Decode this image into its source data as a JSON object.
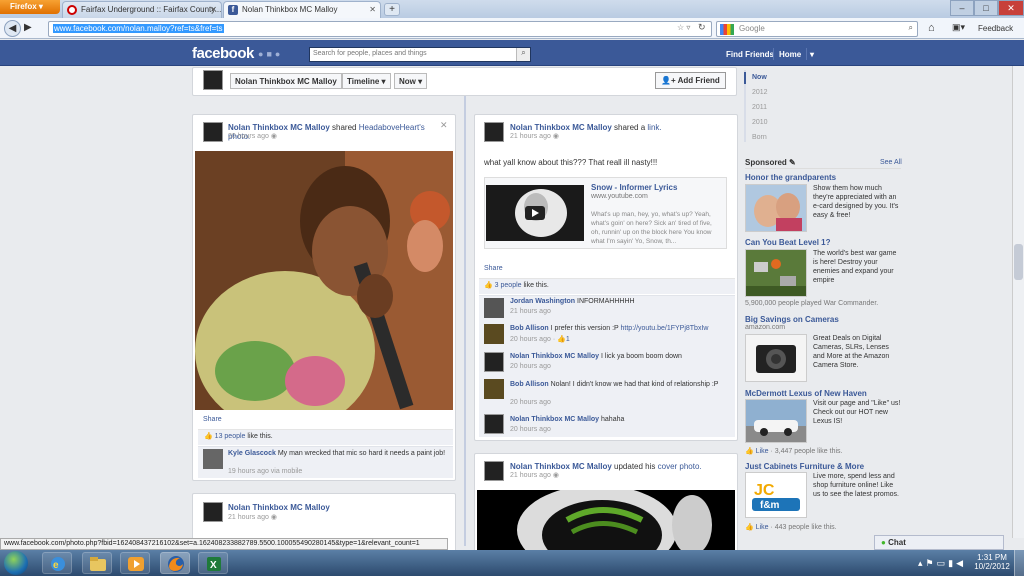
{
  "browser": {
    "menu_button": "Firefox",
    "tabs": [
      {
        "label": "Fairfax Underground :: Fairfax County..."
      },
      {
        "label": "Nolan Thinkbox MC Malloy"
      }
    ],
    "new_tab": "+",
    "url": "www.facebook.com/nolan.malloy?ref=ts&fref=ts",
    "search_placeholder": "Google",
    "feedback_label": "Feedback",
    "status_url": "www.facebook.com/photo.php?fbid=162408437216102&set=a.162408233882789.5500.100055490280145&type=1&relevant_count=1"
  },
  "fb": {
    "logo": "facebook",
    "search_placeholder": "Search for people, places and things",
    "find_friends": "Find Friends",
    "home": "Home"
  },
  "profile_bar": {
    "name_button": "Nolan Thinkbox MC Malloy",
    "timeline_button": "Timeline",
    "now_button": "Now",
    "add_friend": "Add Friend"
  },
  "timeline_nav": [
    "Now",
    "2012",
    "2011",
    "2010",
    "Born"
  ],
  "post1": {
    "author": "Nolan Thinkbox MC Malloy",
    "action": "shared",
    "target": "HeadaboveHeart's photo.",
    "time": "20 hours ago",
    "share": "Share",
    "likes": "13 people",
    "likes_suffix": "like this.",
    "comment_author": "Kyle Glascock",
    "comment_text": "My man wrecked that mic so hard it needs a paint job!",
    "comment_time": "19 hours ago via mobile"
  },
  "post2": {
    "author": "Nolan Thinkbox MC Malloy",
    "action": "shared a",
    "target": "link.",
    "time": "21 hours ago",
    "text": "what yall know about this??? That reall ill nasty!!!",
    "link_title": "Snow - Informer Lyrics",
    "link_domain": "www.youtube.com",
    "link_desc": "What's up man, hey, yo, what's up? Yeah, what's goin' on here? Sick an' tired of five, oh, runnin' up on the block here You know what I'm sayin' Yo, Snow, th...",
    "share": "Share",
    "likes": "3 people",
    "likes_suffix": "like this.",
    "comments": [
      {
        "author": "Jordan Washington",
        "text": "INFORMAHHHHH",
        "time": "21 hours ago"
      },
      {
        "author": "Bob Allison",
        "text": "I prefer this version :P",
        "link": "http://youtu.be/1FYPj8TbxIw",
        "time": "20 hours ago",
        "likes": "1"
      },
      {
        "author": "Nolan Thinkbox MC Malloy",
        "text": "I lick ya boom boom down",
        "time": "20 hours ago"
      },
      {
        "author": "Bob Allison",
        "text": "Nolan! I didn't know we had that kind of relationship :P",
        "time": "20 hours ago"
      },
      {
        "author": "Nolan Thinkbox MC Malloy",
        "text": "hahaha",
        "time": "20 hours ago"
      }
    ]
  },
  "post3": {
    "author": "Nolan Thinkbox MC Malloy",
    "time": "21 hours ago"
  },
  "post4": {
    "author": "Nolan Thinkbox MC Malloy",
    "action": "updated his",
    "target": "cover photo.",
    "time": "21 hours ago"
  },
  "sidebar": {
    "sponsored": "Sponsored",
    "see_all": "See All",
    "ads": [
      {
        "title": "Honor the grandparents",
        "text": "Show them how much they're appreciated with an e-card designed by you. It's easy & free!"
      },
      {
        "title": "Can You Beat Level 1?",
        "text": "The world's best war game is here! Destroy your enemies and expand your empire",
        "footer": "5,900,000 people played War Commander."
      },
      {
        "title": "Big Savings on Cameras",
        "subtitle": "amazon.com",
        "text": "Great Deals on Digital Cameras, SLRs, Lenses and More at the Amazon Camera Store."
      },
      {
        "title": "McDermott Lexus of New Haven",
        "text": "Visit our page and \"Like\" us! Check out our HOT new Lexus IS!",
        "like": "Like",
        "footer": "3,447 people like this."
      },
      {
        "title": "Just Cabinets Furniture & More",
        "text": "Live more, spend less and shop furniture online! Like us to see the latest promos.",
        "like": "Like",
        "footer": "443 people like this."
      }
    ]
  },
  "chat": {
    "label": "Chat"
  },
  "clock": {
    "time": "1:31 PM",
    "date": "10/2/2012"
  }
}
